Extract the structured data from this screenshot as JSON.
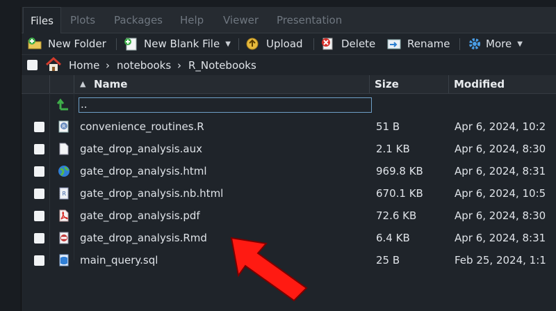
{
  "tabs": [
    "Files",
    "Plots",
    "Packages",
    "Help",
    "Viewer",
    "Presentation"
  ],
  "toolbar": {
    "new_folder": "New Folder",
    "new_blank_file": "New Blank File",
    "upload": "Upload",
    "delete": "Delete",
    "rename": "Rename",
    "more": "More"
  },
  "breadcrumb": {
    "home": "Home",
    "parts": [
      "notebooks",
      "R_Notebooks"
    ],
    "separator": "›"
  },
  "columns": {
    "name": "Name",
    "size": "Size",
    "modified": "Modified",
    "sort_indicator": "▲"
  },
  "up_dir": "..",
  "files": [
    {
      "name": "convenience_routines.R",
      "size": "51 B",
      "modified": "Apr 6, 2024, 10:2",
      "icon": "r-script-icon"
    },
    {
      "name": "gate_drop_analysis.aux",
      "size": "2.1 KB",
      "modified": "Apr 6, 2024, 8:30",
      "icon": "text-file-icon"
    },
    {
      "name": "gate_drop_analysis.html",
      "size": "969.8 KB",
      "modified": "Apr 6, 2024, 8:31",
      "icon": "html-globe-icon"
    },
    {
      "name": "gate_drop_analysis.nb.html",
      "size": "670.1 KB",
      "modified": "Apr 6, 2024, 10:5",
      "icon": "r-notebook-icon"
    },
    {
      "name": "gate_drop_analysis.pdf",
      "size": "72.6 KB",
      "modified": "Apr 6, 2024, 8:30",
      "icon": "pdf-icon"
    },
    {
      "name": "gate_drop_analysis.Rmd",
      "size": "6.4 KB",
      "modified": "Apr 6, 2024, 8:31",
      "icon": "rmarkdown-icon"
    },
    {
      "name": "main_query.sql",
      "size": "25 B",
      "modified": "Feb 25, 2024, 1:1",
      "icon": "sql-file-icon"
    }
  ],
  "colors": {
    "accent_arrow": "#ff1a12",
    "background": "#1f242a"
  }
}
